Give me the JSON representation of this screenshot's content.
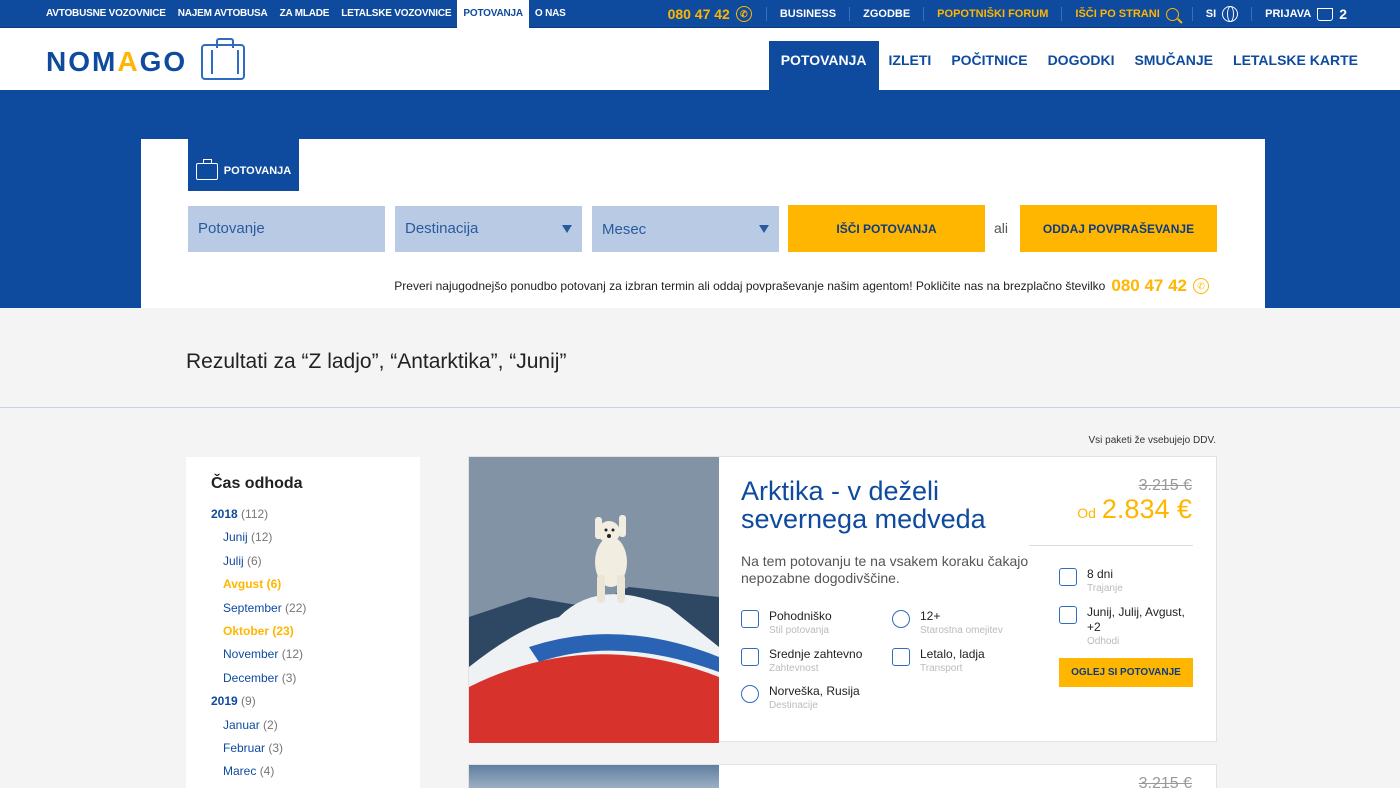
{
  "topnav": {
    "items": [
      "AVTOBUSNE VOZOVNICE",
      "NAJEM AVTOBUSA",
      "ZA MLADE",
      "LETALSKE VOZOVNICE",
      "POTOVANJA",
      "O NAS"
    ],
    "phone": "080 47 42",
    "business": "BUSINESS",
    "zgodbe": "ZGODBE",
    "forum": "POPOTNIŠKI FORUM",
    "search": "IŠČI PO STRANI",
    "lang": "SI",
    "login": "PRIJAVA",
    "basket_count": "2"
  },
  "header": {
    "logo_part1": "NOM",
    "logo_a": "A",
    "logo_part2": "GO",
    "nav": [
      "POTOVANJA",
      "IZLETI",
      "POČITNICE",
      "DOGODKI",
      "SMUČANJE",
      "LETALSKE KARTE"
    ]
  },
  "search": {
    "tab_label": "POTOVANJA",
    "field_trip": "Potovanje",
    "field_destination": "Destinacija",
    "field_month": "Mesec",
    "search_button": "IŠČI POTOVANJA",
    "or": "ali",
    "inquiry_button": "ODDAJ POVPRAŠEVANJE",
    "hint": "Preveri najugodnejšo ponudbo potovanj za izbran termin ali oddaj povpraševanje našim agentom! Pokličite nas na brezplačno številko",
    "hint_phone": "080 47 42"
  },
  "results": {
    "title": "Rezultati za “Z ladjo”, “Antarktika”, “Junij”",
    "vat_note": "Vsi paketi že vsebujejo DDV."
  },
  "sidebar": {
    "title": "Čas odhoda",
    "rows": [
      {
        "label": "2018",
        "count": "(112)"
      },
      {
        "label": "Junij",
        "count": "(12)"
      },
      {
        "label": "Julij",
        "count": "(6)"
      },
      {
        "label": "Avgust",
        "count": "(6)"
      },
      {
        "label": "September",
        "count": "(22)"
      },
      {
        "label": "Oktober",
        "count": "(23)"
      },
      {
        "label": "November",
        "count": "(12)"
      },
      {
        "label": "December",
        "count": "(3)"
      },
      {
        "label": "2019",
        "count": "(9)"
      },
      {
        "label": "Januar",
        "count": "(2)"
      },
      {
        "label": "Februar",
        "count": "(3)"
      },
      {
        "label": "Marec",
        "count": "(4)"
      }
    ]
  },
  "card": {
    "title": "Arktika - v deželi severnega medveda",
    "description": "Na tem potovanju te na vsakem koraku čakajo nepozabne dogodivščine.",
    "style_value": "Pohodniško",
    "style_label": "Stil potovanja",
    "age_value": "12+",
    "age_label": "Starostna omejitev",
    "difficulty_value": "Srednje zahtevno",
    "difficulty_label": "Zahtevnost",
    "transport_value": "Letalo, ladja",
    "transport_label": "Transport",
    "destination_value": "Norveška, Rusija",
    "destination_label": "Destinacije",
    "old_price": "3.215 €",
    "price_prefix": "Od",
    "price": "2.834 €",
    "duration_value": "8 dni",
    "duration_label": "Trajanje",
    "departures_value": "Junij, Julij, Avgust, +2",
    "departures_label": "Odhodi",
    "button": "OGLEJ SI POTOVANJE"
  },
  "card2": {
    "old_price": "3.215 €"
  }
}
